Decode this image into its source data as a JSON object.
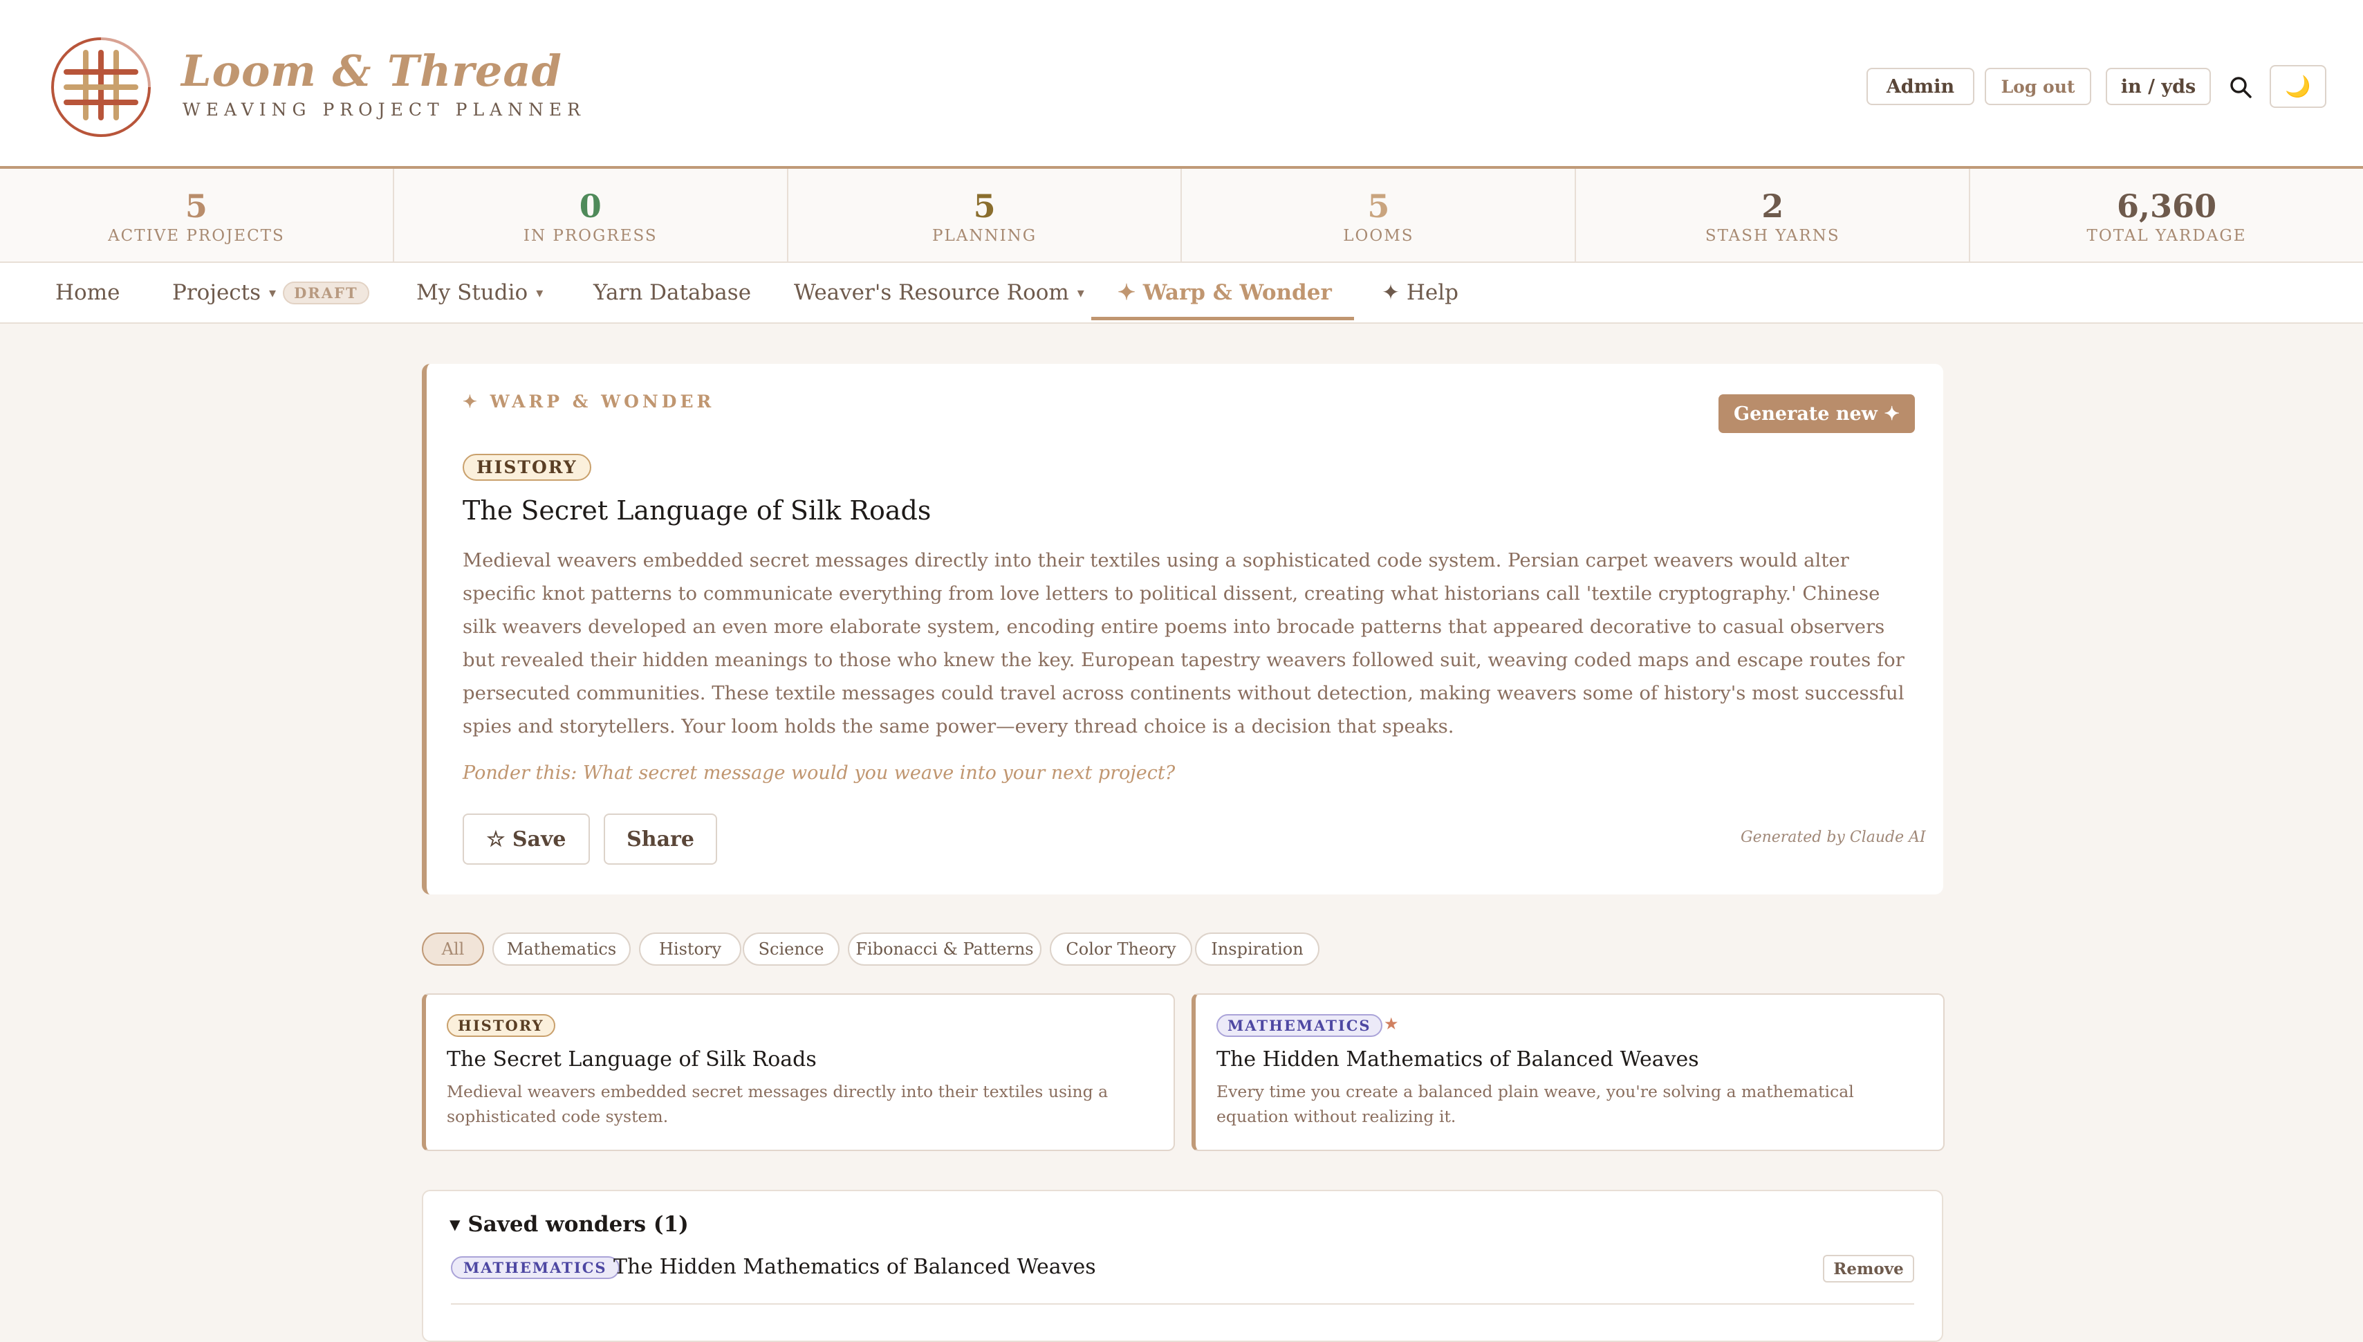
{
  "brand": {
    "title": "Loom & Thread",
    "subtitle": "WEAVING PROJECT PLANNER"
  },
  "header": {
    "admin_label": "Admin",
    "logout_label": "Log out",
    "units_label": "in / yds",
    "search_icon": "search-icon",
    "theme_icon": "🌙"
  },
  "stats": [
    {
      "value": "5",
      "label": "ACTIVE PROJECTS",
      "color": "#b98d6b"
    },
    {
      "value": "0",
      "label": "IN PROGRESS",
      "color": "#4f8a5a"
    },
    {
      "value": "5",
      "label": "PLANNING",
      "color": "#8a6e2e"
    },
    {
      "value": "5",
      "label": "LOOMS",
      "color": "#c9a47e"
    },
    {
      "value": "2",
      "label": "STASH YARNS",
      "color": "#6e5a4c"
    },
    {
      "value": "6,360",
      "label": "TOTAL YARDAGE",
      "color": "#6e5a4c"
    }
  ],
  "nav": {
    "home": "Home",
    "projects": "Projects",
    "projects_badge": "DRAFT",
    "studio": "My Studio",
    "yarn": "Yarn Database",
    "resource": "Weaver's Resource Room",
    "warp": "✦ Warp & Wonder",
    "help": "✦ Help"
  },
  "feature": {
    "kicker": "✦ WARP & WONDER",
    "generate_label": "Generate new ✦",
    "tag": "HISTORY",
    "title": "The Secret Language of Silk Roads",
    "body": "Medieval weavers embedded secret messages directly into their textiles using a sophisticated code system. Persian carpet weavers would alter specific knot patterns to communicate everything from love letters to political dissent, creating what historians call 'textile cryptography.' Chinese silk weavers developed an even more elaborate system, encoding entire poems into brocade patterns that appeared decorative to casual observers but revealed their hidden meanings to those who knew the key. European tapestry weavers followed suit, weaving coded maps and escape routes for persecuted communities. These textile messages could travel across continents without detection, making weavers some of history's most successful spies and storytellers. Your loom holds the same power—every thread choice is a decision that speaks.",
    "ponder": "Ponder this: What secret message would you weave into your next project?",
    "save_label": "☆ Save",
    "share_label": "Share",
    "generated_by": "Generated by Claude AI"
  },
  "filters": [
    "All",
    "Mathematics",
    "History",
    "Science",
    "Fibonacci & Patterns",
    "Color Theory",
    "Inspiration"
  ],
  "cards": [
    {
      "tag": "HISTORY",
      "title": "The Secret Language of Silk Roads",
      "desc": "Medieval weavers embedded secret messages directly into their textiles using a sophisticated code system."
    },
    {
      "tag": "MATHEMATICS",
      "star": "★",
      "title": "The Hidden Mathematics of Balanced Weaves",
      "desc": "Every time you create a balanced plain weave, you're solving a mathematical equation without realizing it."
    }
  ],
  "saved": {
    "heading": "▾ Saved wonders (1)",
    "items": [
      {
        "tag": "MATHEMATICS",
        "title": "The Hidden Mathematics of Balanced Weaves",
        "remove_label": "Remove"
      }
    ]
  },
  "colors": {
    "accent": "#c09670",
    "background": "#f8f4f0"
  }
}
